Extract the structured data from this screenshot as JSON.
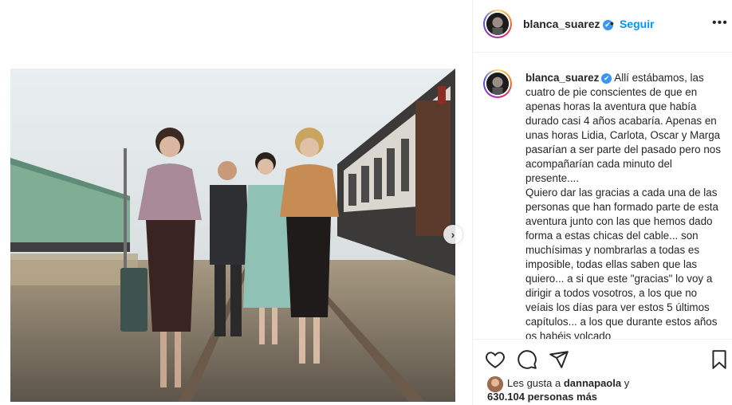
{
  "post": {
    "image_alt": "Cuatro mujeres y un hombre caminando por vías de tren junto a vagones antiguos",
    "next_icon": "chevron-right-icon"
  },
  "header": {
    "username": "blanca_suarez",
    "verified_mark": "✔",
    "separator": "•",
    "follow_label": "Seguir",
    "more_icon": "•••"
  },
  "caption": {
    "username": "blanca_suarez",
    "verified_mark": "✔",
    "text_p1": "Allí estábamos, las cuatro de pie conscientes de que en apenas horas la aventura que había durado casi 4 años acabaría. Apenas en unas horas Lidia, Carlota, Oscar y Marga pasarían a ser parte del pasado pero nos acompañarían cada minuto del presente....",
    "text_p2": "Quiero dar las gracias a cada una de las personas que han formado parte de esta aventura junto con las que hemos dado forma a estas chicas del cable... son muchísimas y nombrarlas a todas es imposible, todas ellas saben que las quiero... a si que este \"gracias\" lo voy a dirigir a todos vosotros, a los que no veíais los días para ver estos 5 últimos capítulos... a los que durante estos años os habéis volcado"
  },
  "actions": {
    "like_icon": "heart-icon",
    "comment_icon": "comment-icon",
    "share_icon": "share-icon",
    "save_icon": "bookmark-icon"
  },
  "likes": {
    "prefix": "Les gusta a",
    "liker": "dannapaola",
    "conj": "y",
    "count_text": "630.104 personas más"
  },
  "colors": {
    "link_blue": "#0095f6",
    "verified_blue": "#3897f0",
    "text": "#262626",
    "border": "#efefef"
  }
}
